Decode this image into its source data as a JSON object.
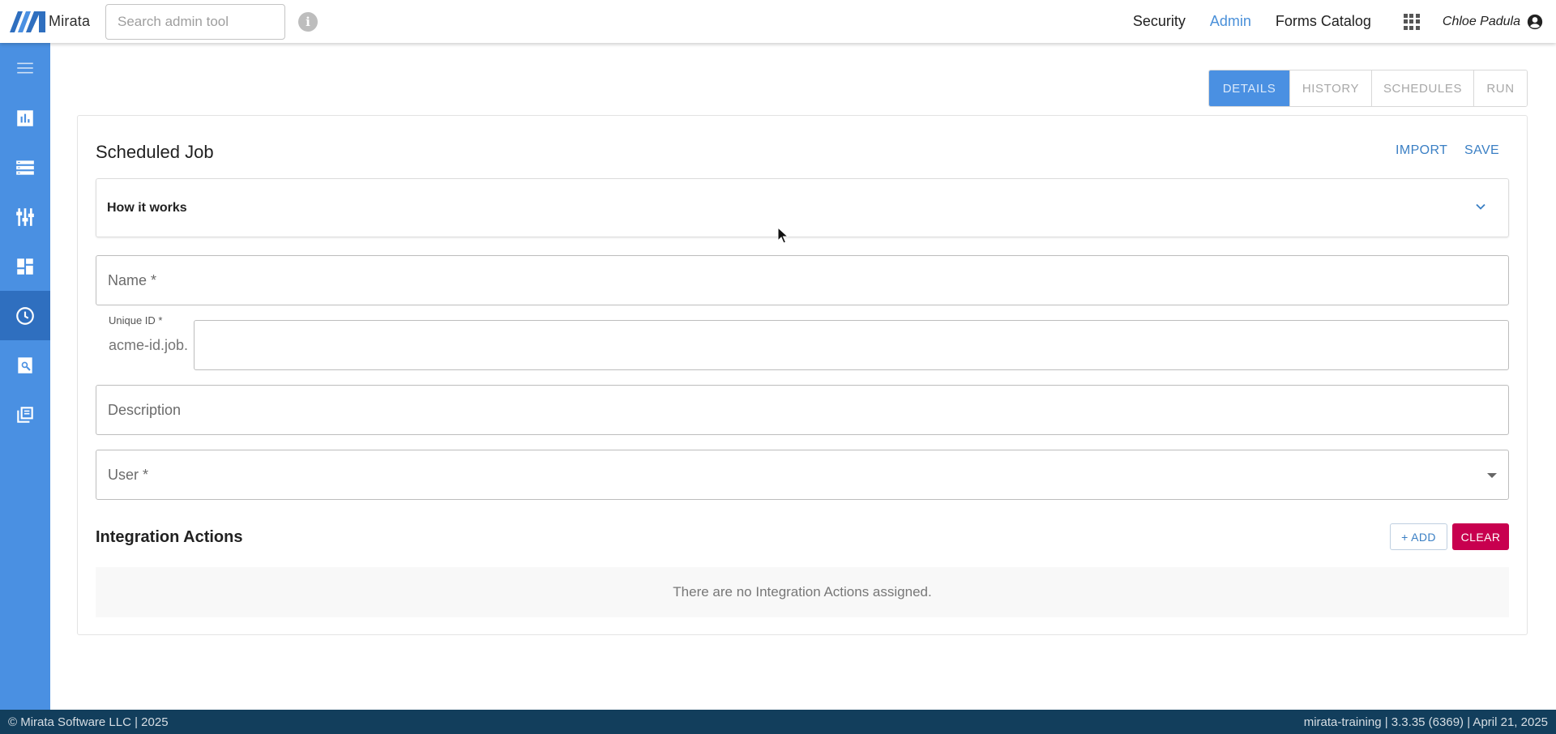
{
  "header": {
    "logo_text": "Mirata",
    "search_placeholder": "Search admin tool",
    "nav": [
      {
        "label": "Security",
        "active": false
      },
      {
        "label": "Admin",
        "active": true
      },
      {
        "label": "Forms Catalog",
        "active": false
      }
    ],
    "user_name": "Chloe Padula"
  },
  "sidebar": {
    "items": [
      {
        "icon": "menu-icon"
      },
      {
        "icon": "bar-chart-icon"
      },
      {
        "icon": "list-icon"
      },
      {
        "icon": "equalizer-icon"
      },
      {
        "icon": "dashboard-icon"
      },
      {
        "icon": "clock-icon",
        "active": true
      },
      {
        "icon": "search-document-icon"
      },
      {
        "icon": "library-icon"
      }
    ],
    "accent_color": "#4a90e2"
  },
  "tabs": [
    {
      "label": "DETAILS",
      "active": true
    },
    {
      "label": "HISTORY",
      "active": false
    },
    {
      "label": "SCHEDULES",
      "active": false
    },
    {
      "label": "RUN",
      "active": false
    }
  ],
  "card": {
    "title": "Scheduled Job",
    "import_label": "IMPORT",
    "save_label": "SAVE",
    "accordion_label": "How it works",
    "name_label": "Name *",
    "uid_label": "Unique ID *",
    "uid_prefix": "acme-id.job.",
    "description_label": "Description",
    "user_label": "User *"
  },
  "integration": {
    "title": "Integration Actions",
    "add_label": "+ ADD",
    "clear_label": "CLEAR",
    "empty_text": "There are no Integration Actions assigned."
  },
  "footer": {
    "left": "© Mirata Software LLC | 2025",
    "right": "mirata-training | 3.3.35 (6369) | April 21, 2025"
  }
}
